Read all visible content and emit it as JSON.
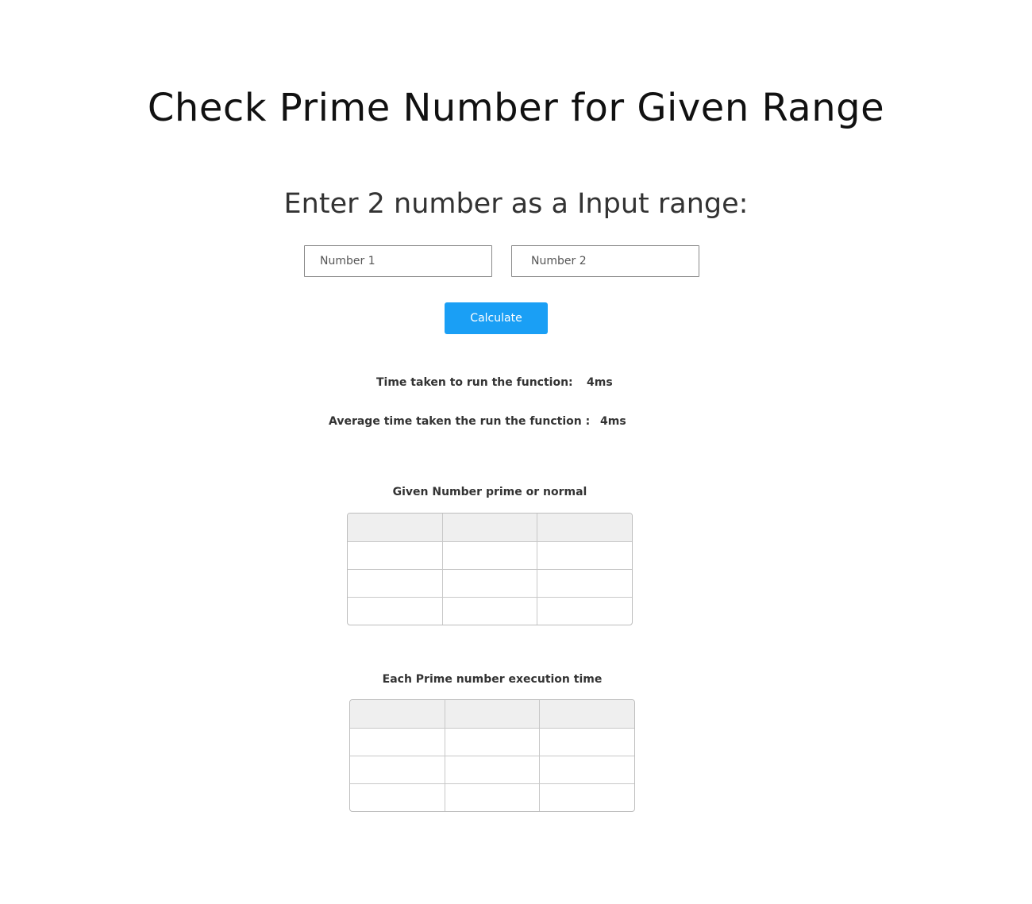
{
  "page": {
    "title": "Check Prime Number for Given Range",
    "subtitle": "Enter 2 number as a Input range:"
  },
  "inputs": {
    "number1": {
      "placeholder": "Number 1",
      "value": ""
    },
    "number2": {
      "placeholder": "Number 2",
      "value": ""
    }
  },
  "actions": {
    "calculate_label": "Calculate"
  },
  "stats": {
    "time_label": "Time taken to run the function:",
    "time_value": "4ms",
    "avg_label": "Average time taken the run the function :",
    "avg_value": "4ms"
  },
  "tables": {
    "prime_or_normal": {
      "caption": "Given Number prime or normal",
      "headers": [
        "",
        "",
        ""
      ],
      "rows": [
        [
          "",
          "",
          ""
        ],
        [
          "",
          "",
          ""
        ],
        [
          "",
          "",
          ""
        ]
      ]
    },
    "execution_time": {
      "caption": "Each Prime number execution time",
      "headers": [
        "",
        "",
        ""
      ],
      "rows": [
        [
          "",
          "",
          ""
        ],
        [
          "",
          "",
          ""
        ],
        [
          "",
          "",
          ""
        ]
      ]
    }
  },
  "colors": {
    "accent": "#1a9ff5",
    "table_header_bg": "#efefef"
  }
}
